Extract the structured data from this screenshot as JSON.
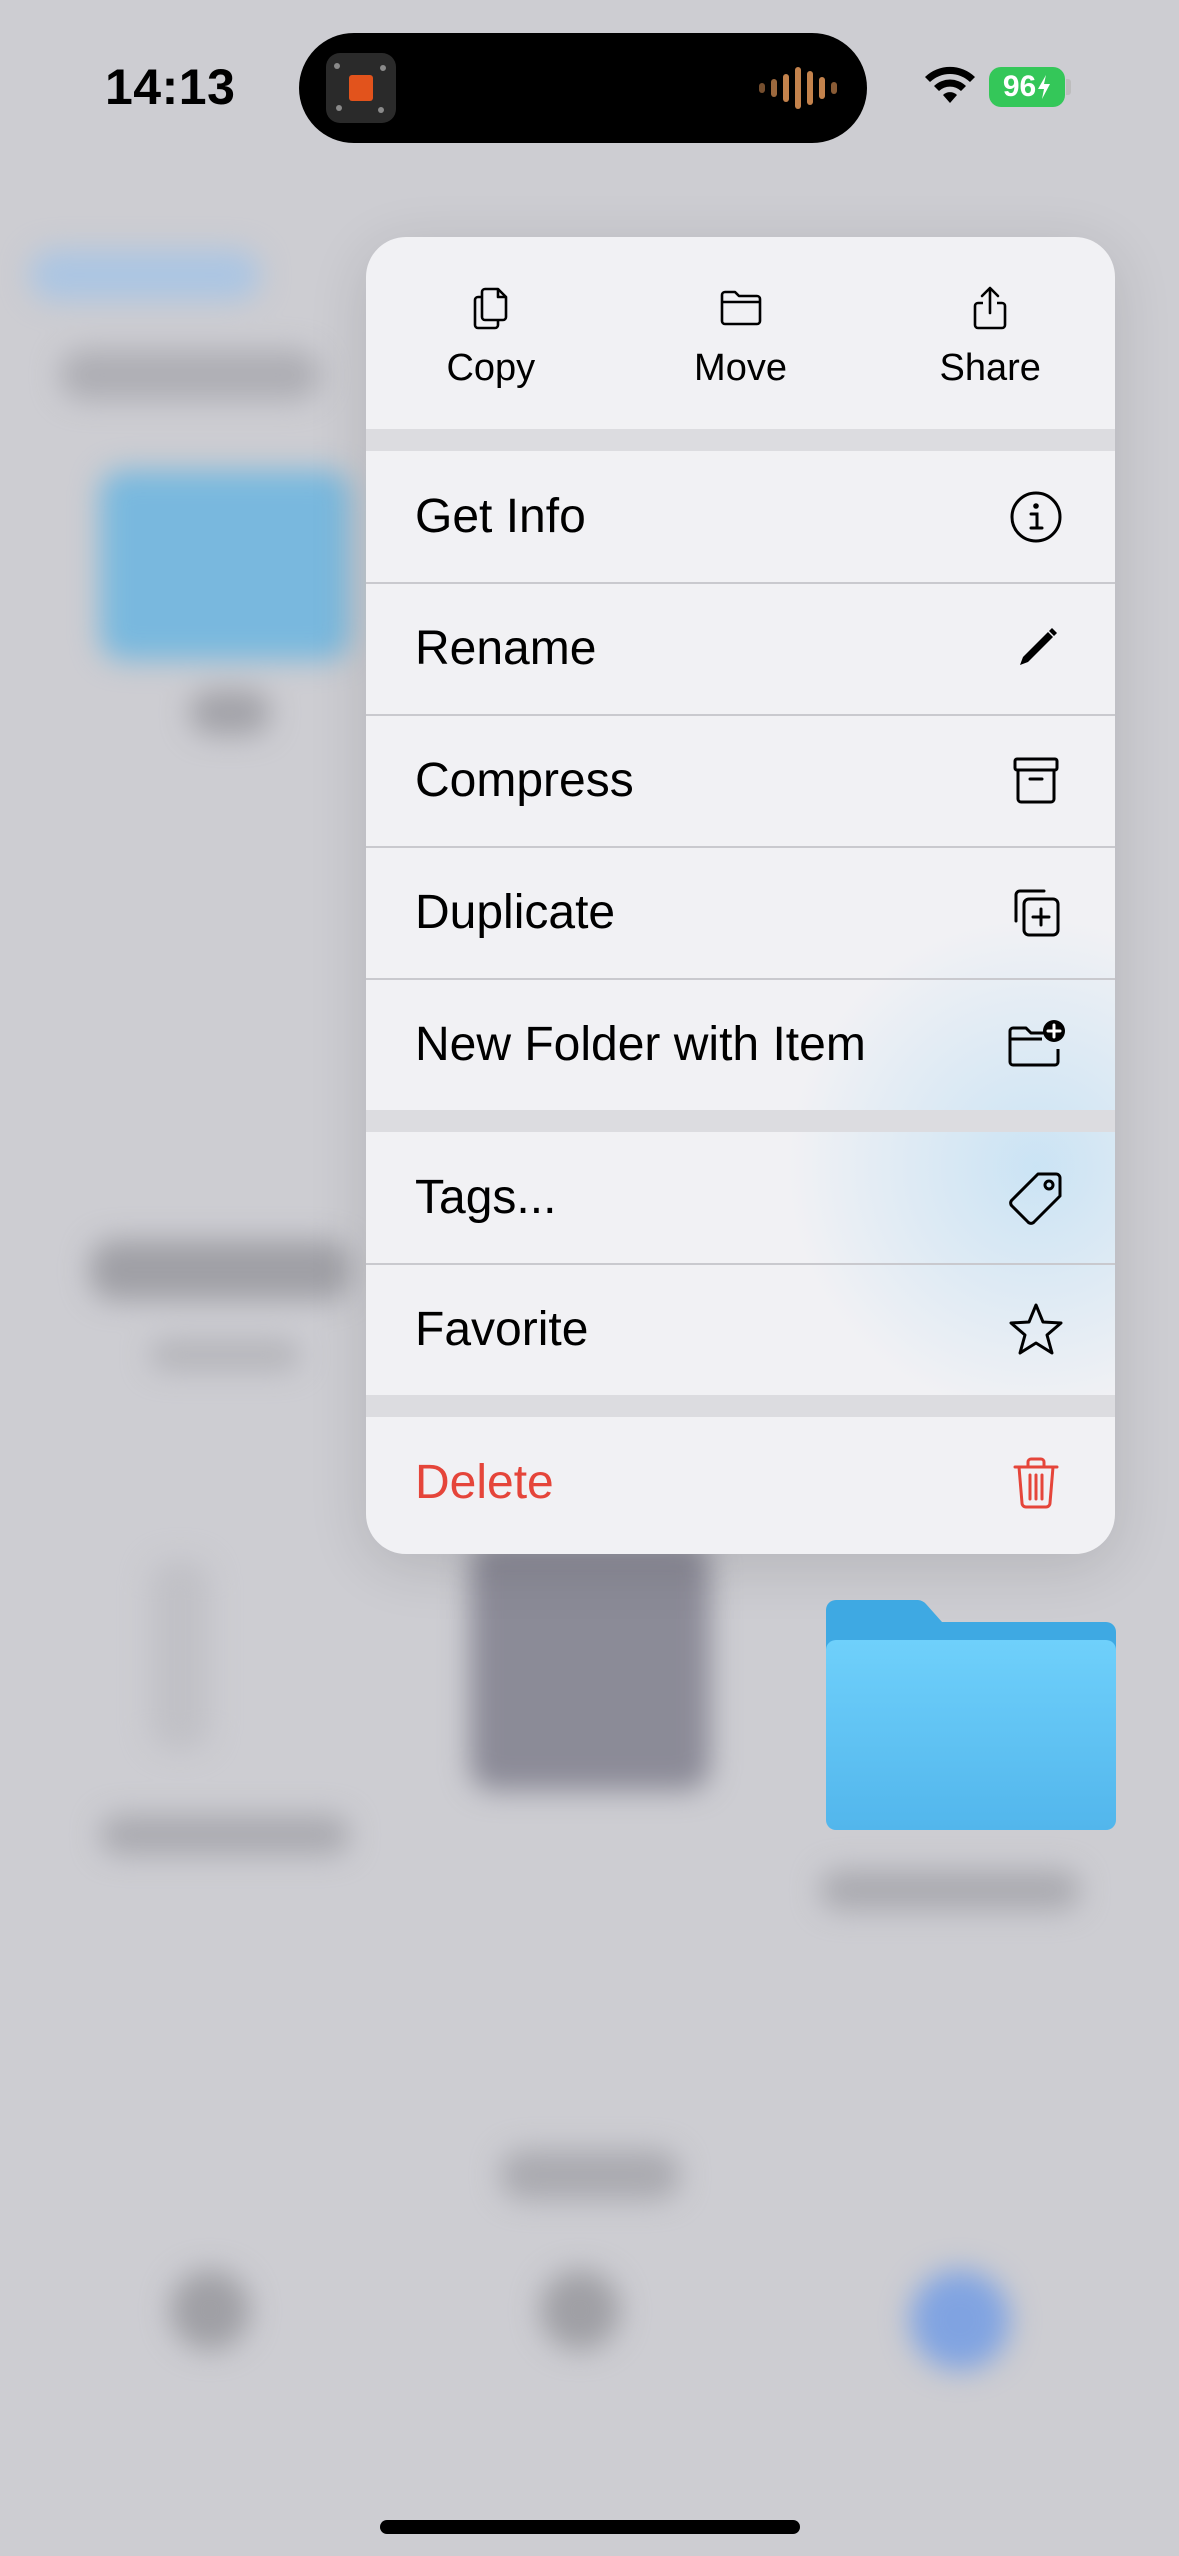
{
  "status_bar": {
    "time": "14:13",
    "battery": "96",
    "battery_color": "#34c759"
  },
  "dynamic_island": {
    "left_icon": "album-art-icon",
    "right_icon": "audio-waveform-icon"
  },
  "context_menu": {
    "quick_actions": [
      {
        "label": "Copy",
        "icon": "copy-icon"
      },
      {
        "label": "Move",
        "icon": "folder-icon"
      },
      {
        "label": "Share",
        "icon": "share-icon"
      }
    ],
    "items": [
      {
        "label": "Get Info",
        "icon": "info-circle-icon"
      },
      {
        "label": "Rename",
        "icon": "pencil-icon"
      },
      {
        "label": "Compress",
        "icon": "archive-box-icon"
      },
      {
        "label": "Duplicate",
        "icon": "duplicate-plus-icon"
      },
      {
        "label": "New Folder with Item",
        "icon": "folder-plus-icon"
      },
      {
        "label": "Tags...",
        "icon": "tag-icon"
      },
      {
        "label": "Favorite",
        "icon": "star-icon"
      },
      {
        "label": "Delete",
        "icon": "trash-icon"
      }
    ],
    "destructive_color": "#e5453a"
  },
  "preview": {
    "icon": "folder-icon",
    "color": "#5ec2f4"
  }
}
